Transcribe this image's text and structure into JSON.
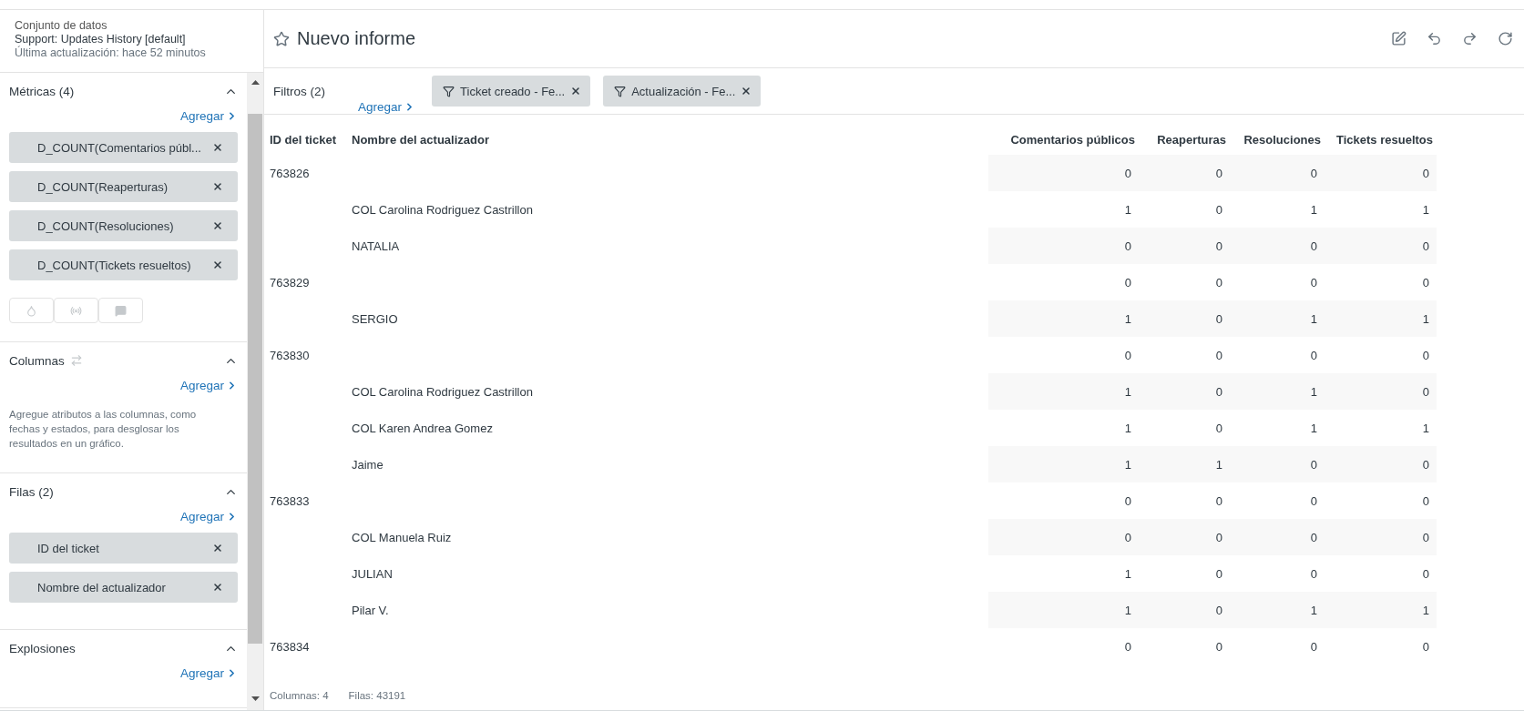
{
  "dataset": {
    "label": "Conjunto de datos",
    "name": "Support: Updates History [default]",
    "updated": "Última actualización: hace 52 minutos"
  },
  "sidebar": {
    "sections": [
      {
        "title": "Métricas (4)",
        "expanded": true,
        "add": "Agregar",
        "chips": [
          "D_COUNT(Comentarios públ...",
          "D_COUNT(Reaperturas)",
          "D_COUNT(Resoluciones)",
          "D_COUNT(Tickets resueltos)"
        ],
        "viz_buttons": true
      },
      {
        "title": "Columnas",
        "expanded": true,
        "swap_icon": true,
        "add": "Agregar",
        "hint": "Agregue atributos a las columnas, como fechas y estados, para desglosar los resultados en un gráfico."
      },
      {
        "title": "Filas (2)",
        "expanded": true,
        "add": "Agregar",
        "chips": [
          "ID del ticket",
          "Nombre del actualizador"
        ]
      },
      {
        "title": "Explosiones",
        "expanded": true,
        "add": "Agregar"
      }
    ]
  },
  "report": {
    "title": "Nuevo informe",
    "starred": false
  },
  "filters": {
    "label": "Filtros (2)",
    "add": "Agregar",
    "chips": [
      "Ticket creado - Fe...",
      "Actualización - Fe..."
    ]
  },
  "table": {
    "columns": [
      "ID del ticket",
      "Nombre del actualizador",
      "Comentarios públicos",
      "Reaperturas",
      "Resoluciones",
      "Tickets resueltos"
    ],
    "rows": [
      {
        "ticket": "763826",
        "values": [
          "0",
          "0",
          "0",
          "0"
        ]
      },
      {
        "updater": "COL Carolina Rodriguez Castrillon",
        "values": [
          "1",
          "0",
          "1",
          "1"
        ]
      },
      {
        "updater": "NATALIA",
        "values": [
          "0",
          "0",
          "0",
          "0"
        ]
      },
      {
        "ticket": "763829",
        "values": [
          "0",
          "0",
          "0",
          "0"
        ]
      },
      {
        "updater": "SERGIO",
        "values": [
          "1",
          "0",
          "1",
          "1"
        ]
      },
      {
        "ticket": "763830",
        "values": [
          "0",
          "0",
          "0",
          "0"
        ]
      },
      {
        "updater": "COL Carolina Rodriguez Castrillon",
        "values": [
          "1",
          "0",
          "1",
          "0"
        ]
      },
      {
        "updater": "COL Karen Andrea Gomez",
        "values": [
          "1",
          "0",
          "1",
          "1"
        ]
      },
      {
        "updater": "Jaime",
        "values": [
          "1",
          "1",
          "0",
          "0"
        ]
      },
      {
        "ticket": "763833",
        "values": [
          "0",
          "0",
          "0",
          "0"
        ]
      },
      {
        "updater": "COL Manuela Ruiz",
        "values": [
          "0",
          "0",
          "0",
          "0"
        ]
      },
      {
        "updater": "JULIAN",
        "values": [
          "1",
          "0",
          "0",
          "0"
        ]
      },
      {
        "updater": "Pilar V.",
        "values": [
          "1",
          "0",
          "1",
          "1"
        ]
      },
      {
        "ticket": "763834",
        "values": [
          "0",
          "0",
          "0",
          "0"
        ]
      }
    ]
  },
  "status_bar": {
    "columns": "Columnas: 4",
    "rows": "Filas: 43191"
  }
}
